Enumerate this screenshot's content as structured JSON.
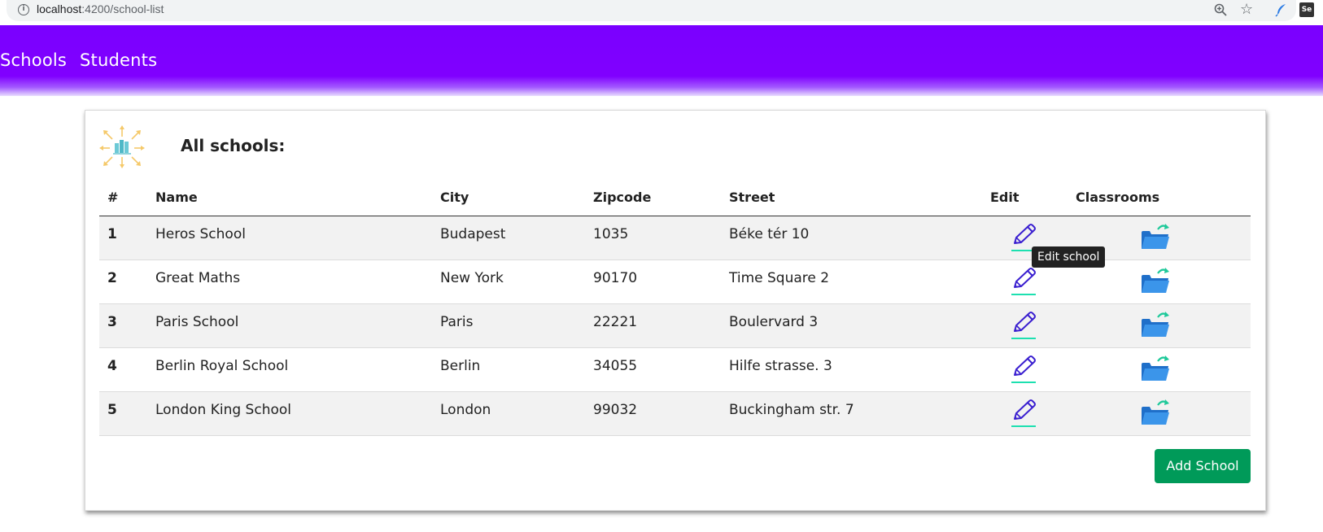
{
  "browser": {
    "url_host": "localhost",
    "url_path": ":4200/school-list",
    "ext_se_label": "Se"
  },
  "navbar": {
    "links": [
      {
        "label": "Schools"
      },
      {
        "label": "Students"
      }
    ],
    "color": "#8000ff"
  },
  "card": {
    "title": "All schools:"
  },
  "table": {
    "headers": [
      "#",
      "Name",
      "City",
      "Zipcode",
      "Street",
      "Edit",
      "Classrooms"
    ],
    "rows": [
      {
        "num": "1",
        "name": "Heros School",
        "city": "Budapest",
        "zipcode": "1035",
        "street": "Béke tér 10"
      },
      {
        "num": "2",
        "name": "Great Maths",
        "city": "New York",
        "zipcode": "90170",
        "street": "Time Square 2"
      },
      {
        "num": "3",
        "name": "Paris School",
        "city": "Paris",
        "zipcode": "22221",
        "street": "Boulervard 3"
      },
      {
        "num": "4",
        "name": "Berlin Royal School",
        "city": "Berlin",
        "zipcode": "34055",
        "street": "Hilfe strasse. 3"
      },
      {
        "num": "5",
        "name": "London King School",
        "city": "London",
        "zipcode": "99032",
        "street": "Buckingham str. 7"
      }
    ],
    "edit_icon": "pencil-icon",
    "classroom_icon": "folder-refresh-icon"
  },
  "tooltip": {
    "text": "Edit school"
  },
  "actions": {
    "add_school_label": "Add School",
    "add_color": "#009a59"
  }
}
